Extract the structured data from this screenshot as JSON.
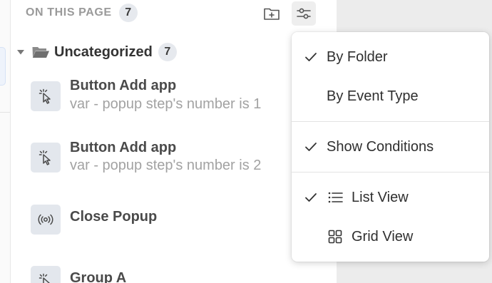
{
  "header": {
    "title": "ON THIS PAGE",
    "count": "7",
    "add_folder_icon": "folder-plus-icon",
    "filter_icon": "sliders-icon"
  },
  "folder": {
    "name": "Uncategorized",
    "count": "7",
    "expanded": true
  },
  "items": [
    {
      "name": "Button Add app",
      "subtitle": "var - popup step's number is 1",
      "icon": "cursor-click-icon"
    },
    {
      "name": "Button Add app",
      "subtitle": "var - popup step's number is 2",
      "icon": "cursor-click-icon"
    },
    {
      "name": "Close Popup",
      "subtitle": "",
      "icon": "broadcast-icon"
    },
    {
      "name": "Group A",
      "subtitle": "",
      "icon": "cursor-click-icon"
    }
  ],
  "menu": {
    "group_by": [
      {
        "label": "By Folder",
        "checked": true
      },
      {
        "label": "By Event Type",
        "checked": false
      }
    ],
    "options": [
      {
        "label": "Show Conditions",
        "checked": true
      }
    ],
    "views": [
      {
        "label": "List View",
        "checked": true,
        "icon": "list-icon"
      },
      {
        "label": "Grid View",
        "checked": false,
        "icon": "grid-icon"
      }
    ]
  },
  "colors": {
    "badge_bg": "#e6e9ee",
    "item_icon_bg": "#e3e7ed",
    "muted_text": "#a2a2a2",
    "backdrop": "#ececec"
  }
}
